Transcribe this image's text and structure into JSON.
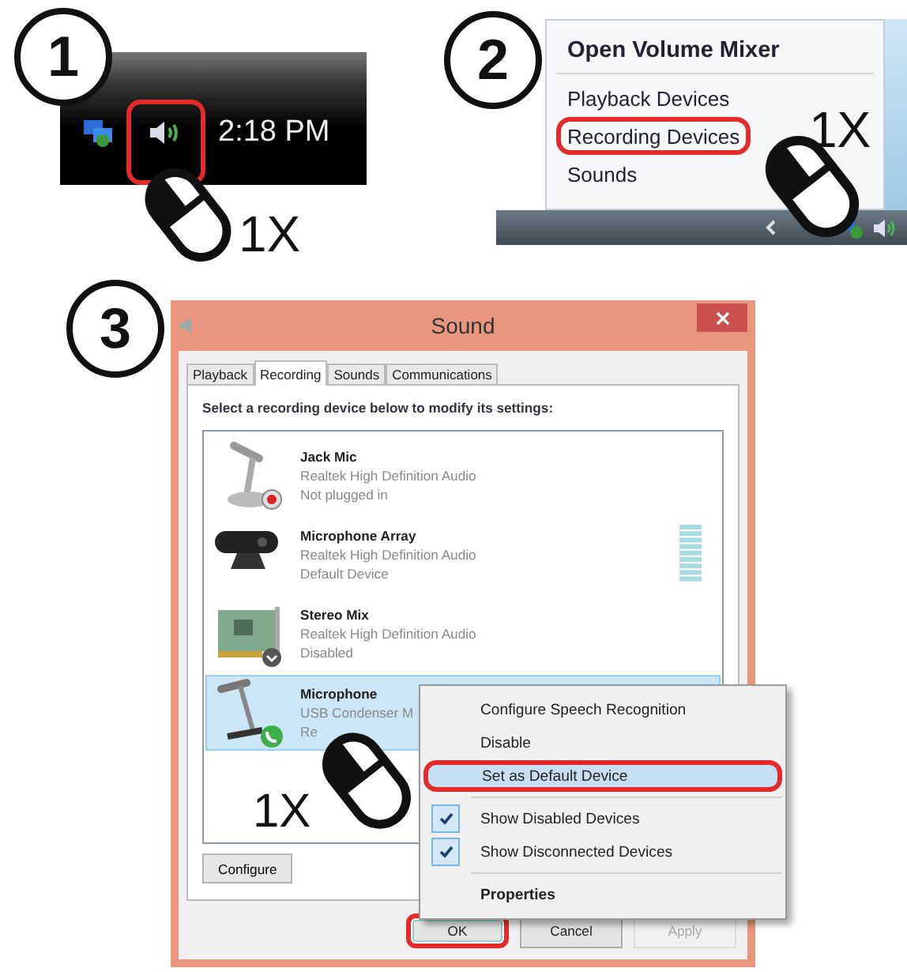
{
  "steps": [
    {
      "number": "1"
    },
    {
      "number": "2"
    },
    {
      "number": "3"
    }
  ],
  "tray": {
    "clock": "2:18 PM",
    "volume_highlighted": true,
    "clicks": "1X"
  },
  "volume_menu": {
    "items": [
      {
        "label": "Open Volume Mixer",
        "bold": true,
        "highlighted": false
      },
      {
        "label": "Playback Devices",
        "bold": false,
        "highlighted": false
      },
      {
        "label": "Recording Devices",
        "bold": false,
        "highlighted": true
      },
      {
        "label": "Sounds",
        "bold": false,
        "highlighted": false
      }
    ],
    "clicks": "1X"
  },
  "sound_window": {
    "title": "Sound",
    "tabs": [
      {
        "label": "Playback",
        "selected": false
      },
      {
        "label": "Recording",
        "selected": true
      },
      {
        "label": "Sounds",
        "selected": false
      },
      {
        "label": "Communications",
        "selected": false
      }
    ],
    "instruction": "Select a recording device below to modify its settings:",
    "devices": [
      {
        "kind": "desk-mic",
        "name": "Jack Mic",
        "driver": "Realtek High Definition Audio",
        "status": "Not plugged in",
        "unplugged": true,
        "disabled": false,
        "default_communications": false,
        "meter": false,
        "selected": false
      },
      {
        "kind": "webcam",
        "name": "Microphone Array",
        "driver": "Realtek High Definition Audio",
        "status": "Default Device",
        "unplugged": false,
        "disabled": false,
        "default_communications": false,
        "meter": true,
        "selected": false
      },
      {
        "kind": "sound-card",
        "name": "Stereo Mix",
        "driver": "Realtek High Definition Audio",
        "status": "Disabled",
        "unplugged": false,
        "disabled": true,
        "default_communications": false,
        "meter": false,
        "selected": false
      },
      {
        "kind": "studio-mic",
        "name": "Microphone",
        "driver": "USB Condenser M",
        "status": "Re",
        "unplugged": false,
        "disabled": false,
        "default_communications": true,
        "meter": false,
        "selected": true
      }
    ],
    "configure": "Configure",
    "buttons": [
      {
        "label": "OK",
        "highlighted": true,
        "disabled": false
      },
      {
        "label": "Cancel",
        "highlighted": false,
        "disabled": false
      },
      {
        "label": "Apply",
        "highlighted": false,
        "disabled": true
      }
    ],
    "clicks": "1X"
  },
  "context_menu": {
    "groups": [
      [
        {
          "label": "Configure Speech Recognition",
          "checked": false,
          "selected": false,
          "highlighted": false,
          "bold": false
        },
        {
          "label": "Disable",
          "checked": false,
          "selected": false,
          "highlighted": false,
          "bold": false
        },
        {
          "label": "Set as Default Device",
          "checked": false,
          "selected": true,
          "highlighted": true,
          "bold": false
        }
      ],
      [
        {
          "label": "Show Disabled Devices",
          "checked": true,
          "selected": false,
          "highlighted": false,
          "bold": false
        },
        {
          "label": "Show Disconnected Devices",
          "checked": true,
          "selected": false,
          "highlighted": false,
          "bold": false
        }
      ],
      [
        {
          "label": "Properties",
          "checked": false,
          "selected": false,
          "highlighted": false,
          "bold": true
        }
      ]
    ]
  }
}
